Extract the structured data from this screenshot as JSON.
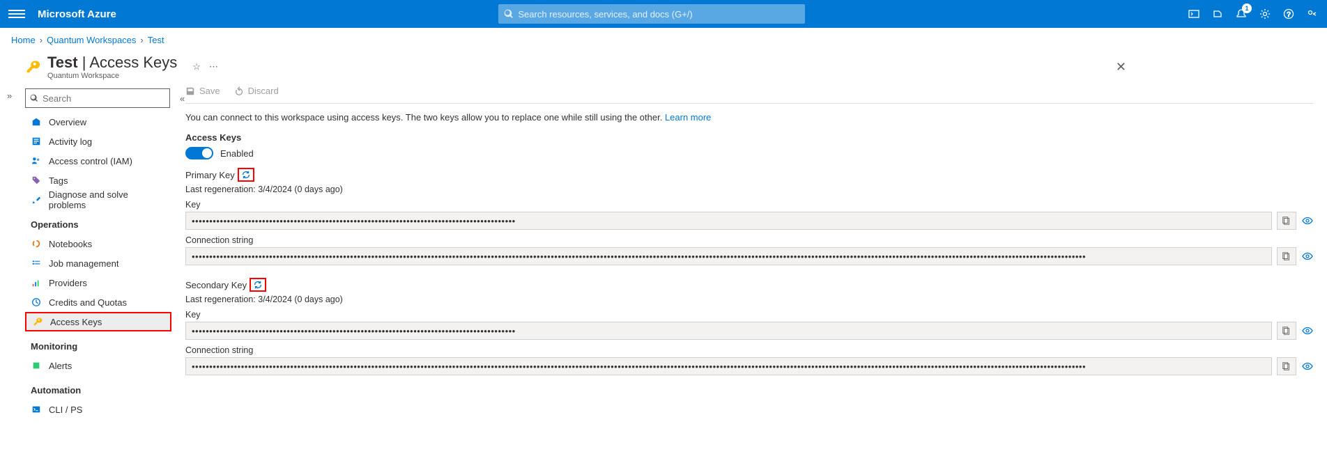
{
  "brand": "Microsoft Azure",
  "search_placeholder": "Search resources, services, and docs (G+/)",
  "notification_count": "1",
  "breadcrumb": {
    "home": "Home",
    "workspaces": "Quantum Workspaces",
    "resource": "Test"
  },
  "title": {
    "name": "Test",
    "section": "Access Keys",
    "subtitle": "Quantum Workspace"
  },
  "sidebar_search_placeholder": "Search",
  "sidebar": {
    "overview": "Overview",
    "activity": "Activity log",
    "iam": "Access control (IAM)",
    "tags": "Tags",
    "diagnose": "Diagnose and solve problems",
    "operations_header": "Operations",
    "notebooks": "Notebooks",
    "job": "Job management",
    "providers": "Providers",
    "credits": "Credits and Quotas",
    "keys": "Access Keys",
    "monitoring_header": "Monitoring",
    "alerts": "Alerts",
    "automation_header": "Automation",
    "cli": "CLI / PS"
  },
  "commands": {
    "save": "Save",
    "discard": "Discard"
  },
  "intro_text": "You can connect to this workspace using access keys. The two keys allow you to replace one while still using the other. ",
  "learn_more": "Learn more",
  "access_keys_label": "Access Keys",
  "enabled_label": "Enabled",
  "primary": {
    "heading": "Primary Key",
    "regen": "Last regeneration: 3/4/2024 (0 days ago)",
    "key_label": "Key",
    "key_value": "••••••••••••••••••••••••••••••••••••••••••••••••••••••••••••••••••••••••••••••••••••••••••••",
    "conn_label": "Connection string",
    "conn_value": "••••••••••••••••••••••••••••••••••••••••••••••••••••••••••••••••••••••••••••••••••••••••••••••••••••••••••••••••••••••••••••••••••••••••••••••••••••••••••••••••••••••••••••••••••••••••••••••••••••••••••••••••••••••••••••••••••••••••••••••••••••••••••••••"
  },
  "secondary": {
    "heading": "Secondary Key",
    "regen": "Last regeneration: 3/4/2024 (0 days ago)",
    "key_label": "Key",
    "key_value": "••••••••••••••••••••••••••••••••••••••••••••••••••••••••••••••••••••••••••••••••••••••••••••",
    "conn_label": "Connection string",
    "conn_value": "••••••••••••••••••••••••••••••••••••••••••••••••••••••••••••••••••••••••••••••••••••••••••••••••••••••••••••••••••••••••••••••••••••••••••••••••••••••••••••••••••••••••••••••••••••••••••••••••••••••••••••••••••••••••••••••••••••••••••••••••••••••••••••••"
  }
}
